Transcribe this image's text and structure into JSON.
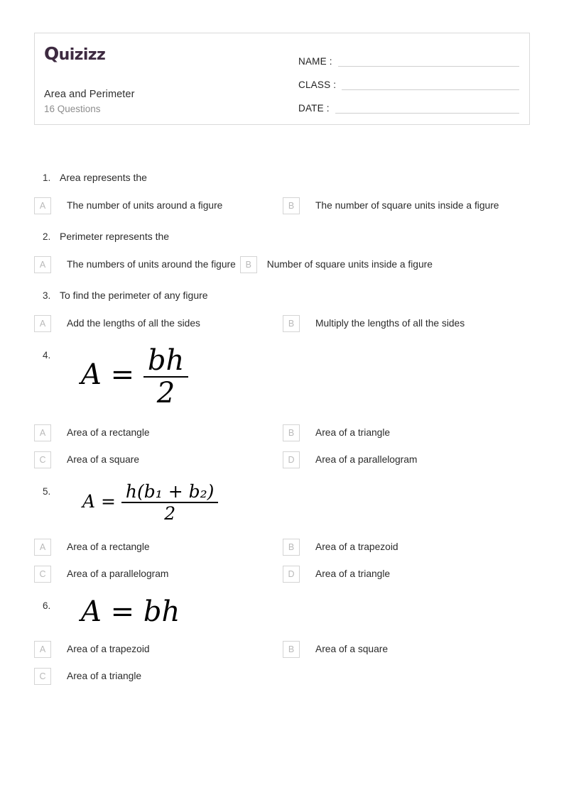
{
  "header": {
    "brand": "Quizizz",
    "brand_first_letter": "Q",
    "brand_rest": "uizizz",
    "quiz_title": "Area and Perimeter",
    "question_count_label": "16 Questions",
    "fields": [
      {
        "label": "NAME :",
        "value": ""
      },
      {
        "label": "CLASS :",
        "value": ""
      },
      {
        "label": "DATE  :",
        "value": ""
      }
    ],
    "brand_color": "#3d2a40"
  },
  "questions": [
    {
      "number": "1.",
      "type": "text",
      "text": "Area represents the",
      "layout": "half",
      "options": [
        {
          "letter": "A",
          "text": "The number of units around a figure"
        },
        {
          "letter": "B",
          "text": "The number of square units inside a figure"
        }
      ]
    },
    {
      "number": "2.",
      "type": "text",
      "text": "Perimeter represents the",
      "layout": "auto",
      "options": [
        {
          "letter": "A",
          "text": "The numbers of units around the figure"
        },
        {
          "letter": "B",
          "text": "Number of square units inside a figure"
        }
      ]
    },
    {
      "number": "3.",
      "type": "text",
      "text": "To find the perimeter of any figure",
      "layout": "half",
      "options": [
        {
          "letter": "A",
          "text": "Add the lengths of all the sides"
        },
        {
          "letter": "B",
          "text": "Multiply the lengths of all the sides"
        }
      ]
    },
    {
      "number": "4.",
      "type": "formula",
      "formula": "A = bh/2",
      "formula_parts": {
        "lhs": "A",
        "eq": "=",
        "numerator": "bh",
        "denominator": "2"
      },
      "layout": "half",
      "options": [
        {
          "letter": "A",
          "text": "Area of a rectangle"
        },
        {
          "letter": "B",
          "text": "Area of a triangle"
        },
        {
          "letter": "C",
          "text": "Area of a square"
        },
        {
          "letter": "D",
          "text": "Area of a parallelogram"
        }
      ]
    },
    {
      "number": "5.",
      "type": "formula",
      "formula": "A = h(b1 + b2)/2",
      "formula_parts": {
        "lhs": "A",
        "eq": "=",
        "numerator": "h(b₁ + b₂)",
        "denominator": "2"
      },
      "layout": "half",
      "options": [
        {
          "letter": "A",
          "text": "Area of a rectangle"
        },
        {
          "letter": "B",
          "text": "Area of a trapezoid"
        },
        {
          "letter": "C",
          "text": "Area of a parallelogram"
        },
        {
          "letter": "D",
          "text": "Area of a triangle"
        }
      ]
    },
    {
      "number": "6.",
      "type": "formula",
      "formula": "A = bh",
      "formula_parts": {
        "lhs": "A",
        "eq": "=",
        "rhs": "bh"
      },
      "layout": "half",
      "options": [
        {
          "letter": "A",
          "text": "Area of a trapezoid"
        },
        {
          "letter": "B",
          "text": "Area of a square"
        },
        {
          "letter": "C",
          "text": "Area of a triangle"
        }
      ]
    }
  ]
}
